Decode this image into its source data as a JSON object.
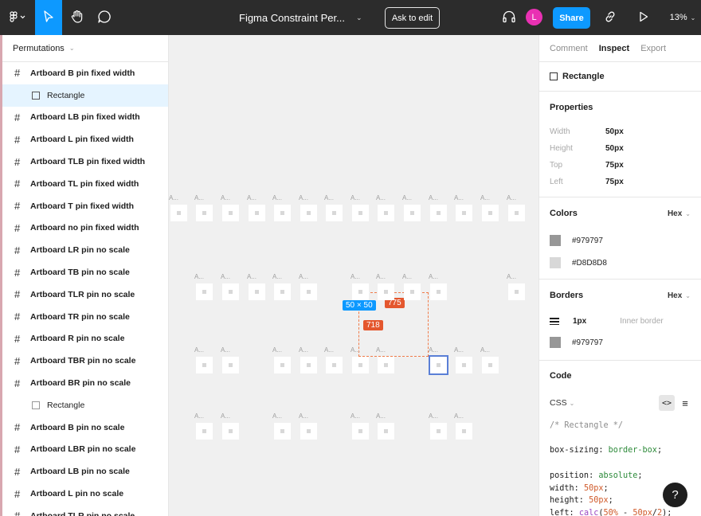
{
  "toolbar": {
    "file_title": "Figma Constraint Per...",
    "ask_to_edit_label": "Ask to edit",
    "avatar_initial": "L",
    "share_label": "Share",
    "zoom_level": "13%",
    "icons": [
      "figma-logo-icon",
      "move-tool-icon",
      "hand-tool-icon",
      "comment-tool-icon",
      "headset-icon",
      "link-icon",
      "play-icon"
    ]
  },
  "pages": {
    "current": "Permutations"
  },
  "layers": [
    {
      "label": "Artboard B pin fixed width",
      "type": "frame"
    },
    {
      "label": "Rectangle",
      "type": "child",
      "selected": true
    },
    {
      "label": "Artboard LB pin fixed width",
      "type": "frame"
    },
    {
      "label": "Artboard L pin fixed width",
      "type": "frame"
    },
    {
      "label": "Artboard TLB pin fixed width",
      "type": "frame"
    },
    {
      "label": "Artboard TL pin fixed width",
      "type": "frame"
    },
    {
      "label": "Artboard T pin fixed width",
      "type": "frame"
    },
    {
      "label": "Artboard no pin fixed width",
      "type": "frame"
    },
    {
      "label": "Artboard LR pin no scale",
      "type": "frame"
    },
    {
      "label": "Artboard TB pin no scale",
      "type": "frame"
    },
    {
      "label": "Artboard TLR pin no scale",
      "type": "frame"
    },
    {
      "label": "Artboard TR pin no scale",
      "type": "frame"
    },
    {
      "label": "Artboard R pin no scale",
      "type": "frame"
    },
    {
      "label": "Artboard TBR pin no scale",
      "type": "frame"
    },
    {
      "label": "Artboard BR pin no scale",
      "type": "frame"
    },
    {
      "label": "Rectangle",
      "type": "child"
    },
    {
      "label": "Artboard B pin no scale",
      "type": "frame"
    },
    {
      "label": "Artboard LBR pin no scale",
      "type": "frame"
    },
    {
      "label": "Artboard LB pin no scale",
      "type": "frame"
    },
    {
      "label": "Artboard L pin no scale",
      "type": "frame"
    },
    {
      "label": "Artboard TLR pin no scale",
      "type": "frame"
    }
  ],
  "canvas": {
    "artboard_label": "A...",
    "size_tag": "50 × 50",
    "distance_horizontal": "775",
    "distance_vertical": "718"
  },
  "inspect": {
    "tabs": [
      "Comment",
      "Inspect",
      "Export"
    ],
    "active_tab": "Inspect",
    "selection_name": "Rectangle",
    "properties_title": "Properties",
    "properties": [
      {
        "key": "Width",
        "value": "50px"
      },
      {
        "key": "Height",
        "value": "50px"
      },
      {
        "key": "Top",
        "value": "75px"
      },
      {
        "key": "Left",
        "value": "75px"
      }
    ],
    "colors_title": "Colors",
    "colors_format": "Hex",
    "colors": [
      {
        "hex": "#979797",
        "label": "#979797"
      },
      {
        "hex": "#D8D8D8",
        "label": "#D8D8D8"
      }
    ],
    "borders_title": "Borders",
    "borders_format": "Hex",
    "border_width": "1px",
    "border_type": "Inner border",
    "border_color": {
      "hex": "#979797",
      "label": "#979797"
    },
    "code_title": "Code",
    "code_language": "CSS",
    "code_toggle_label": "<>"
  },
  "help_label": "?"
}
